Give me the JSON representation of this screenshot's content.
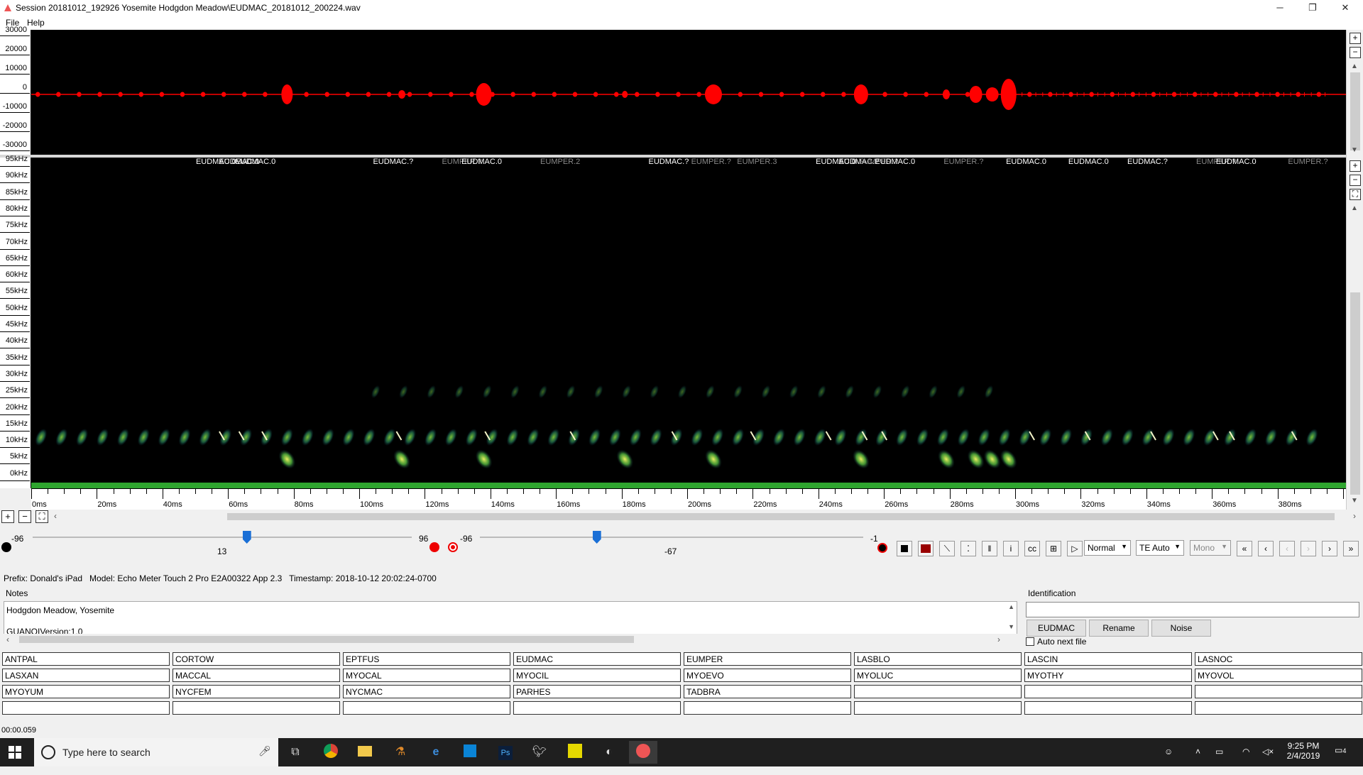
{
  "window": {
    "title": "Session 20181012_192926 Yosemite Hodgdon Meadow\\EUDMAC_20181012_200224.wav",
    "minimize": "─",
    "restore": "❐",
    "close": "✕"
  },
  "menu": [
    "File",
    "Help"
  ],
  "waveform": {
    "color": "#ff0000",
    "axis_labels": [
      "30000",
      "20000",
      "10000",
      "0",
      "-10000",
      "-20000",
      "-30000"
    ]
  },
  "spectrogram": {
    "freq_labels": [
      "95kHz",
      "90kHz",
      "85kHz",
      "80kHz",
      "75kHz",
      "70kHz",
      "65kHz",
      "60kHz",
      "55kHz",
      "50kHz",
      "45kHz",
      "40kHz",
      "35kHz",
      "30kHz",
      "25kHz",
      "20kHz",
      "15kHz",
      "10kHz",
      "5kHz",
      "0kHz"
    ],
    "time_labels": [
      "0ms",
      "20ms",
      "40ms",
      "60ms",
      "80ms",
      "100ms",
      "120ms",
      "140ms",
      "160ms",
      "180ms",
      "200ms",
      "220ms",
      "240ms",
      "260ms",
      "280ms",
      "300ms",
      "320ms",
      "340ms",
      "360ms",
      "380ms"
    ],
    "id_labels": [
      {
        "text": "EUDMAC.0",
        "time_ms": 58,
        "color": "#ffffff"
      },
      {
        "text": "EUDMAC.0",
        "time_ms": 65,
        "color": "#ffffff"
      },
      {
        "text": "EUDMAC.0",
        "time_ms": 70,
        "color": "#ffffff"
      },
      {
        "text": "EUDMAC.?",
        "time_ms": 112,
        "color": "#ffffff"
      },
      {
        "text": "EUMPER.?",
        "time_ms": 133,
        "color": "#888888"
      },
      {
        "text": "EUDMAC.0",
        "time_ms": 139,
        "color": "#ffffff"
      },
      {
        "text": "EUMPER.2",
        "time_ms": 163,
        "color": "#888888"
      },
      {
        "text": "EUDMAC.?",
        "time_ms": 196,
        "color": "#ffffff"
      },
      {
        "text": "EUMPER.?",
        "time_ms": 209,
        "color": "#888888"
      },
      {
        "text": "EUMPER.3",
        "time_ms": 223,
        "color": "#888888"
      },
      {
        "text": "EUDMAC.0",
        "time_ms": 247,
        "color": "#ffffff"
      },
      {
        "text": "EUDMAC.?",
        "time_ms": 254,
        "color": "#ffffff"
      },
      {
        "text": "EUMPER.?",
        "time_ms": 260,
        "color": "#888888"
      },
      {
        "text": "EUDMAC.0",
        "time_ms": 265,
        "color": "#ffffff"
      },
      {
        "text": "EUMPER.?",
        "time_ms": 286,
        "color": "#888888"
      },
      {
        "text": "EUDMAC.0",
        "time_ms": 305,
        "color": "#ffffff"
      },
      {
        "text": "EUDMAC.0",
        "time_ms": 324,
        "color": "#ffffff"
      },
      {
        "text": "EUDMAC.?",
        "time_ms": 342,
        "color": "#ffffff"
      },
      {
        "text": "EUMPER.?",
        "time_ms": 363,
        "color": "#888888"
      },
      {
        "text": "EUDMAC.0",
        "time_ms": 369,
        "color": "#ffffff"
      },
      {
        "text": "EUMPER.?",
        "time_ms": 391,
        "color": "#888888"
      }
    ]
  },
  "controls": {
    "slider1": {
      "min": "-96",
      "max": "96",
      "value": "13",
      "fraction": 0.565
    },
    "slider2": {
      "min": "-96",
      "max": "-1",
      "value": "-67",
      "fraction": 0.305
    },
    "mode_select": "Normal",
    "te_select": "TE Auto",
    "channel_select": "Mono"
  },
  "info": {
    "prefix": "Prefix: Donald's iPad",
    "model": "Model: Echo Meter Touch 2 Pro E2A00322 App 2.3",
    "timestamp": "Timestamp: 2018-10-12 20:02:24-0700"
  },
  "notes": {
    "label": "Notes",
    "line1": "Hodgdon Meadow, Yosemite",
    "line2": "GUANOIVersion:1.0"
  },
  "identification": {
    "label": "Identification",
    "value": "",
    "primary_button": "EUDMAC",
    "rename_button": "Rename",
    "noise_button": "Noise",
    "auto_next": "Auto next file"
  },
  "species": [
    "ANTPAL",
    "CORTOW",
    "EPTFUS",
    "EUDMAC",
    "EUMPER",
    "LASBLO",
    "LASCIN",
    "LASNOC",
    "LASXAN",
    "MACCAL",
    "MYOCAL",
    "MYOCIL",
    "MYOEVO",
    "MYOLUC",
    "MYOTHY",
    "MYOVOL",
    "MYOYUM",
    "NYCFEM",
    "NYCMAC",
    "PARHES",
    "TADBRA",
    "",
    "",
    "",
    "",
    "",
    "",
    "",
    "",
    "",
    "",
    ""
  ],
  "status": "00:00.059",
  "taskbar": {
    "search_placeholder": "Type here to search",
    "time": "9:25 PM",
    "date": "2/4/2019",
    "notifications": "4"
  }
}
